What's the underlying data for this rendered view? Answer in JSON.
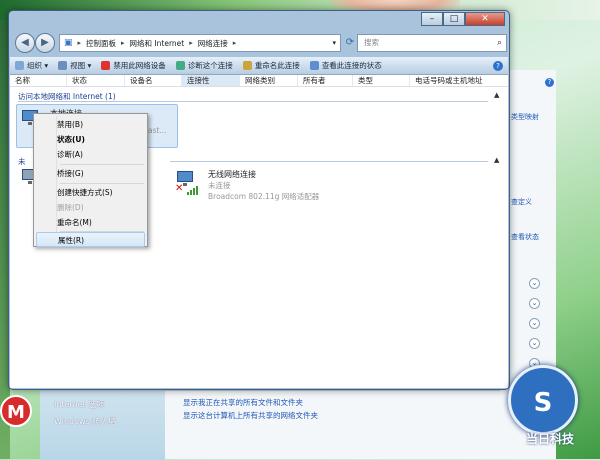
{
  "window": {
    "address": [
      "控制面板",
      "网络和 Internet",
      "网络连接"
    ],
    "search_placeholder": "搜索"
  },
  "toolbar": {
    "items": [
      "组织",
      "视图",
      "禁用此网络设备",
      "诊断这个连接",
      "重命名此连接",
      "查看此连接的状态"
    ]
  },
  "columns": [
    "名称",
    "状态",
    "设备名",
    "连接性",
    "网络类别",
    "所有者",
    "类型",
    "电话号码或主机地址"
  ],
  "groups": {
    "local": "访问本地网络和 Internet (1)",
    "unknown": "未"
  },
  "items": {
    "local": {
      "name": "本地连接",
      "sub": "ast..."
    },
    "wireless": {
      "name": "无线网络连接",
      "status": "未连接",
      "device": "Broadcom 802.11g 网络适配器"
    }
  },
  "context_menu": [
    {
      "label": "禁用(B)",
      "style": "normal"
    },
    {
      "label": "状态(U)",
      "style": "bold"
    },
    {
      "label": "诊断(A)",
      "style": "normal"
    },
    {
      "label": "桥接(G)",
      "style": "normal"
    },
    {
      "label": "创建快捷方式(S)",
      "style": "normal"
    },
    {
      "label": "删除(D)",
      "style": "disabled"
    },
    {
      "label": "重命名(M)",
      "style": "normal"
    },
    {
      "label": "属性(R)",
      "style": "highlighted"
    }
  ],
  "background_window": {
    "links": [
      "类型映射",
      "查定义",
      "查看状态"
    ],
    "bottom_side": [
      "Internet 选项",
      "Windows 防火墙"
    ],
    "bottom_links": [
      "显示我正在共享的所有文件和文件夹",
      "显示这台计算机上所有共享的网络文件夹"
    ]
  },
  "logo": {
    "badge": "S",
    "text": "当日科技"
  },
  "desktop": {
    "metro": "M"
  }
}
